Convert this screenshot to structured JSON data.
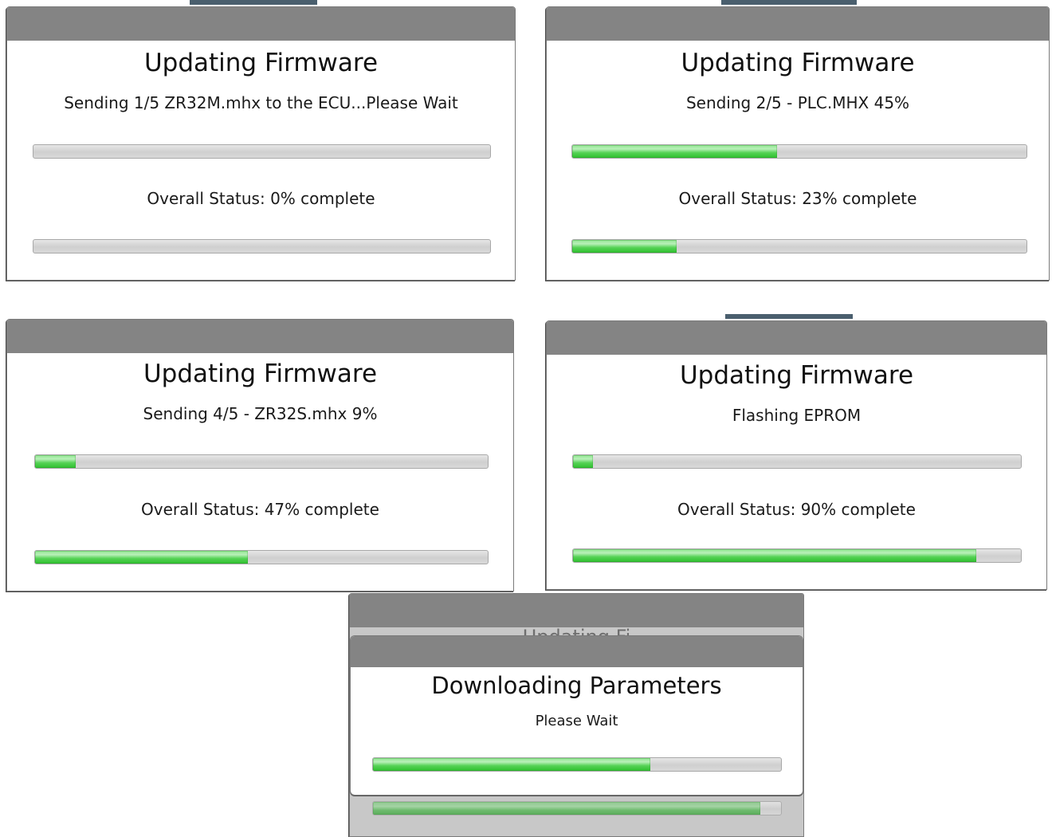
{
  "dialogs": [
    {
      "heading": "Updating Firmware",
      "status": "Sending 1/5 ZR32M.mhx to the ECU...Please Wait",
      "file_progress": 0.0,
      "overall_label": "Overall Status: 0% complete",
      "overall_progress": 0.0
    },
    {
      "heading": "Updating Firmware",
      "status": "Sending 2/5 - PLC.MHX 45%",
      "file_progress": 0.45,
      "overall_label": "Overall Status: 23% complete",
      "overall_progress": 0.23
    },
    {
      "heading": "Updating Firmware",
      "status": "Sending 4/5 - ZR32S.mhx 9%",
      "file_progress": 0.09,
      "overall_label": "Overall Status: 47% complete",
      "overall_progress": 0.47
    },
    {
      "heading": "Updating Firmware",
      "status": "Flashing EPROM",
      "file_progress": 0.045,
      "overall_label": "Overall Status: 90% complete",
      "overall_progress": 0.9
    }
  ],
  "download_dialog": {
    "heading": "Downloading Parameters",
    "status": "Please Wait",
    "progress": 0.68,
    "background_heading_fragment": "Updating Fi",
    "background_progress": 0.95
  },
  "colors": {
    "titlebar": "#848484",
    "progress_green": "#3ccb3c",
    "progress_track": "#d4d4d4"
  }
}
